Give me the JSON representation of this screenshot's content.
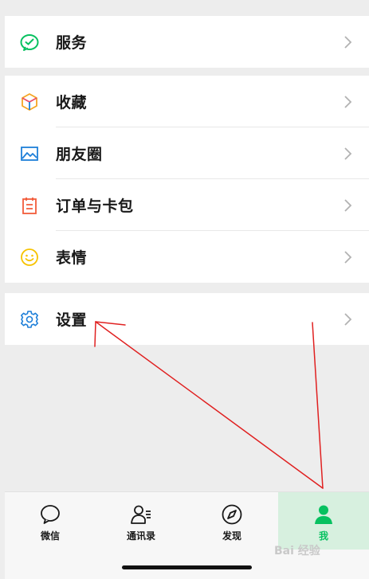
{
  "menu_groups": [
    {
      "items": [
        {
          "label": "服务"
        }
      ]
    },
    {
      "items": [
        {
          "label": "收藏"
        },
        {
          "label": "朋友圈"
        },
        {
          "label": "订单与卡包"
        },
        {
          "label": "表情"
        }
      ]
    },
    {
      "items": [
        {
          "label": "设置"
        }
      ]
    }
  ],
  "tabbar": {
    "tabs": [
      {
        "label": "微信",
        "icon": "chat-bubble-icon"
      },
      {
        "label": "通讯录",
        "icon": "contacts-icon"
      },
      {
        "label": "发现",
        "icon": "compass-icon"
      },
      {
        "label": "我",
        "icon": "person-icon",
        "active": true
      }
    ]
  },
  "watermark": "Bai 经验",
  "colors": {
    "accent_green": "#07c160",
    "annotation_red": "#e02020",
    "background": "#ededed",
    "icon_services": "#07c160",
    "icon_favorites": "#f5a623",
    "icon_moments": "#1e7fd9",
    "icon_orders": "#f25c3b",
    "icon_stickers": "#f7c300",
    "icon_settings": "#1e7fd9"
  }
}
